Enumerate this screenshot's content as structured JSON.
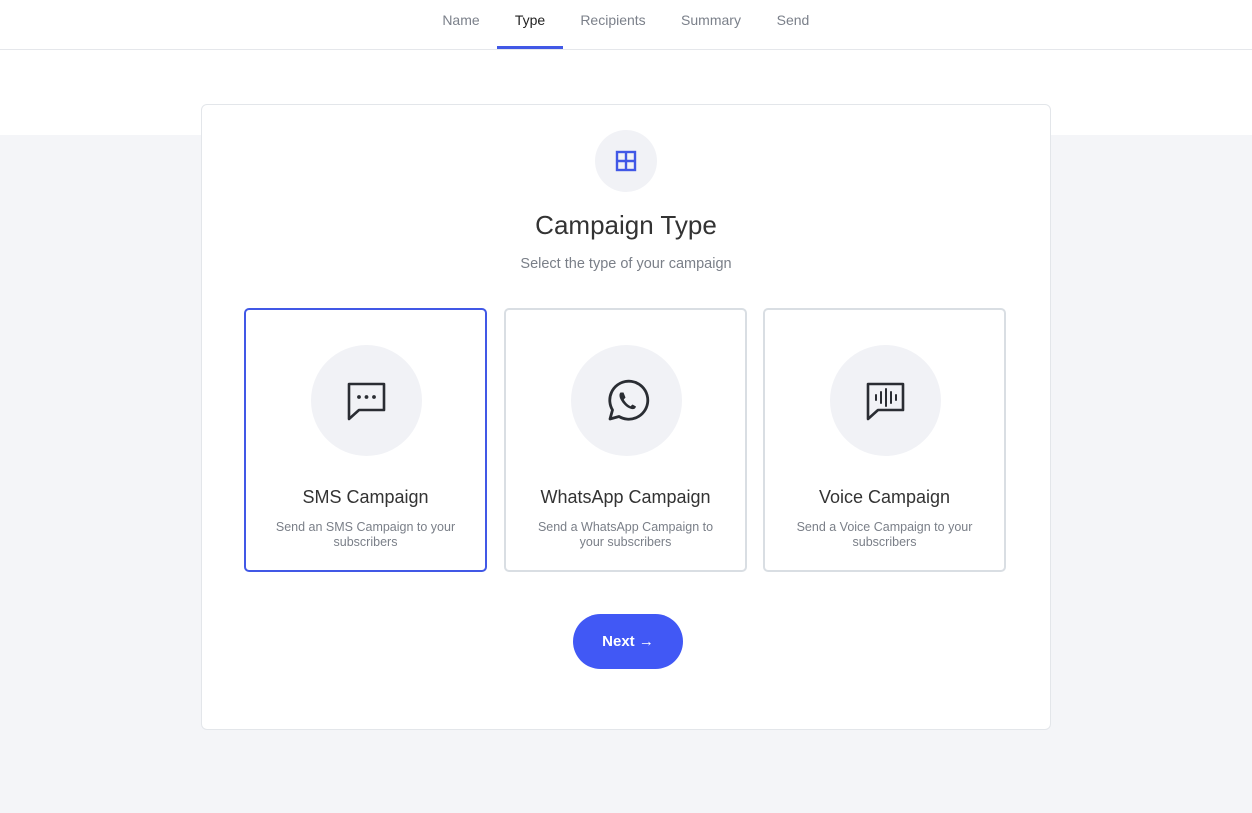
{
  "nav": {
    "tabs": [
      {
        "label": "Name"
      },
      {
        "label": "Type"
      },
      {
        "label": "Recipients"
      },
      {
        "label": "Summary"
      },
      {
        "label": "Send"
      }
    ],
    "active_tab": "Type"
  },
  "header": {
    "icon": "grid-icon",
    "title": "Campaign Type",
    "subtitle": "Select the type of your campaign"
  },
  "options": [
    {
      "icon": "chat-dots-icon",
      "title": "SMS Campaign",
      "description": "Send an SMS Campaign to your subscribers",
      "selected": true
    },
    {
      "icon": "whatsapp-icon",
      "title": "WhatsApp Campaign",
      "description": "Send a WhatsApp Campaign to your subscribers",
      "selected": false
    },
    {
      "icon": "voice-wave-icon",
      "title": "Voice Campaign",
      "description": "Send a Voice Campaign to your subscribers",
      "selected": false
    }
  ],
  "actions": {
    "next_label": "Next →"
  },
  "colors": {
    "accent": "#4158e6",
    "button": "#4158f5",
    "icon_bg": "#f1f2f6",
    "page_bg": "#f4f5f8"
  }
}
